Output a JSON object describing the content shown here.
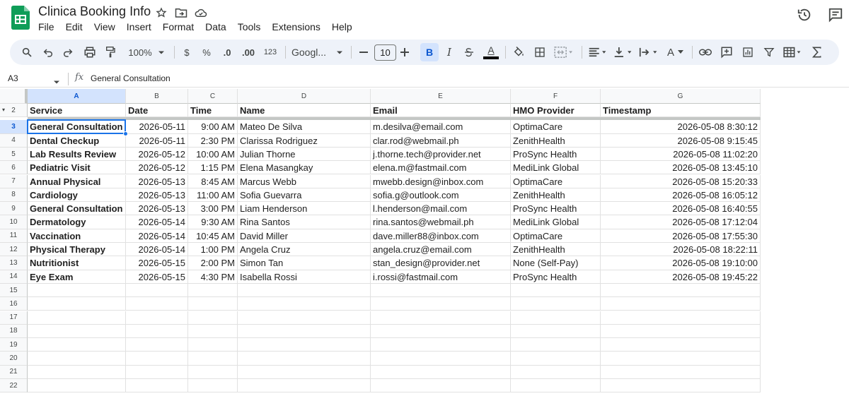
{
  "app": {
    "title": "Clinica Booking Info",
    "menu": [
      "File",
      "Edit",
      "View",
      "Insert",
      "Format",
      "Data",
      "Tools",
      "Extensions",
      "Help"
    ],
    "icons": {
      "logo": "sheets-logo-icon",
      "star": "star-icon",
      "move": "move-to-folder-icon",
      "cloud": "cloud-saved-icon",
      "history": "history-icon",
      "comments": "comments-icon"
    },
    "colors": {
      "brand": "#0f9d58",
      "accent": "#1a73e8",
      "toolbar_bg": "#eef2f9"
    }
  },
  "toolbar": {
    "zoom": "100%",
    "currency": "$",
    "percent": "%",
    "decrease_decimal": ".0",
    "increase_decimal": ".00",
    "number_format": "123",
    "font": "Googl...",
    "font_size": "10",
    "bold": "B",
    "italic": "I",
    "text_color": "A",
    "text_rotation": "A"
  },
  "formula_bar": {
    "name_box": "A3",
    "fx": "fx",
    "value": "General Consultation"
  },
  "sheet": {
    "columns": [
      "A",
      "B",
      "C",
      "D",
      "E",
      "F",
      "G"
    ],
    "selected_column": "A",
    "selected_row": "3",
    "headers": [
      "Service",
      "Date",
      "Time",
      "Name",
      "Email",
      "HMO Provider",
      "Timestamp"
    ],
    "row_numbers": [
      "2",
      "3",
      "4",
      "5",
      "6",
      "7",
      "8",
      "9",
      "10",
      "11",
      "12",
      "13",
      "14",
      "15",
      "16",
      "17",
      "18",
      "19",
      "20",
      "21",
      "22"
    ],
    "rows": [
      [
        "General Consultation",
        "2026-05-11",
        "9:00 AM",
        "Mateo De Silva",
        "m.desilva@email.com",
        "OptimaCare",
        "2026-05-08 8:30:12"
      ],
      [
        "Dental Checkup",
        "2026-05-11",
        "2:30 PM",
        "Clarissa Rodriguez",
        "clar.rod@webmail.ph",
        "ZenithHealth",
        "2026-05-08 9:15:45"
      ],
      [
        "Lab Results Review",
        "2026-05-12",
        "10:00 AM",
        "Julian Thorne",
        "j.thorne.tech@provider.net",
        "ProSync Health",
        "2026-05-08 11:02:20"
      ],
      [
        "Pediatric Visit",
        "2026-05-12",
        "1:15 PM",
        "Elena Masangkay",
        "elena.m@fastmail.com",
        "MediLink Global",
        "2026-05-08 13:45:10"
      ],
      [
        "Annual Physical",
        "2026-05-13",
        "8:45 AM",
        "Marcus Webb",
        "mwebb.design@inbox.com",
        "OptimaCare",
        "2026-05-08 15:20:33"
      ],
      [
        "Cardiology",
        "2026-05-13",
        "11:00 AM",
        "Sofia Guevarra",
        "sofia.g@outlook.com",
        "ZenithHealth",
        "2026-05-08 16:05:12"
      ],
      [
        "General Consultation",
        "2026-05-13",
        "3:00 PM",
        "Liam Henderson",
        "l.henderson@mail.com",
        "ProSync Health",
        "2026-05-08 16:40:55"
      ],
      [
        "Dermatology",
        "2026-05-14",
        "9:30 AM",
        "Rina Santos",
        "rina.santos@webmail.ph",
        "MediLink Global",
        "2026-05-08 17:12:04"
      ],
      [
        "Vaccination",
        "2026-05-14",
        "10:45 AM",
        "David Miller",
        "dave.miller88@inbox.com",
        "OptimaCare",
        "2026-05-08 17:55:30"
      ],
      [
        "Physical Therapy",
        "2026-05-14",
        "1:00 PM",
        "Angela Cruz",
        "angela.cruz@email.com",
        "ZenithHealth",
        "2026-05-08 18:22:11"
      ],
      [
        "Nutritionist",
        "2026-05-15",
        "2:00 PM",
        "Simon Tan",
        "stan_design@provider.net",
        "None (Self-Pay)",
        "2026-05-08 19:10:00"
      ],
      [
        "Eye Exam",
        "2026-05-15",
        "4:30 PM",
        "Isabella Rossi",
        "i.rossi@fastmail.com",
        "ProSync Health",
        "2026-05-08 19:45:22"
      ]
    ]
  }
}
